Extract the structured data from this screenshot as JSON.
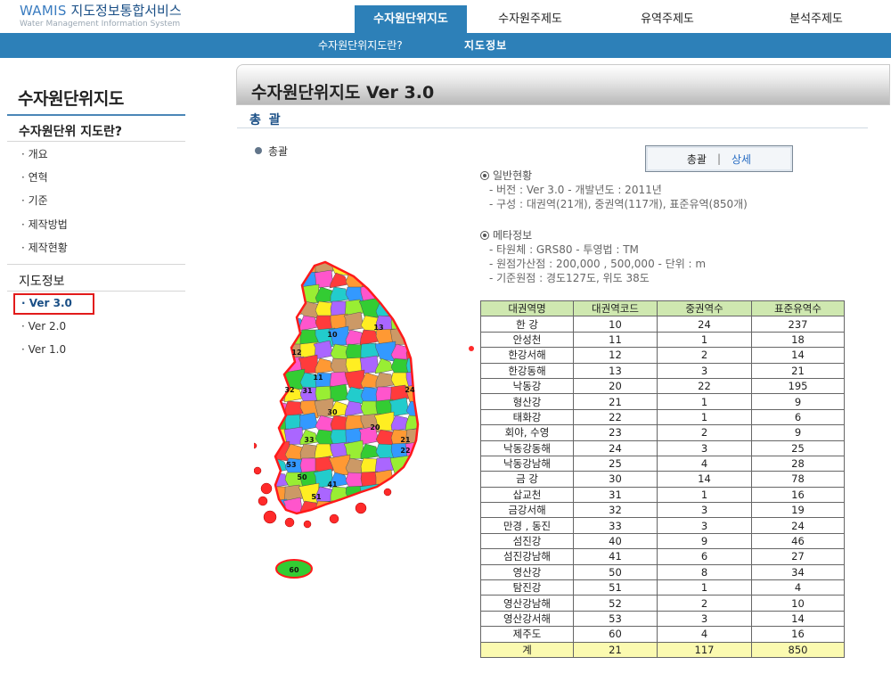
{
  "header": {
    "logo_brand": "WAMIS",
    "logo_title": "지도정보통합서비스",
    "logo_subtitle": "Water Management Information System",
    "main_menu": [
      "수자원단위지도",
      "수자원주제도",
      "유역주제도",
      "분석주제도"
    ],
    "sub_menu": [
      "수자원단위지도란?",
      "지도정보"
    ]
  },
  "sidebar": {
    "title": "수자원단위지도",
    "section1_title": "수자원단위 지도란?",
    "section1_items": [
      "· 개요",
      "· 연혁",
      "· 기준",
      "· 제작방법",
      "· 제작현황"
    ],
    "section2_title": "지도정보",
    "section2_items": [
      "· Ver 3.0",
      "· Ver 2.0",
      "· Ver 1.0"
    ],
    "active_item": "· Ver 3.0"
  },
  "content": {
    "page_title": "수자원단위지도 Ver 3.0",
    "tab_label": "총 괄",
    "bullet_label": "총괄",
    "toggle_summary": "총괄",
    "toggle_separator": "|",
    "toggle_detail": "상세",
    "general": {
      "heading": "일반현황",
      "lines": [
        "-  버전 : Ver 3.0        -  개발년도 : 2011년",
        "-  구성 : 대권역(21개), 중권역(117개), 표준유역(850개)"
      ]
    },
    "meta": {
      "heading": "메타정보",
      "lines": [
        "-  타원체 : GRS80     -  투영법 : TM",
        "-  원점가산점 : 200,000 , 500,000          -  단위 : m",
        "-  기준원점 : 경도127도, 위도 38도"
      ]
    }
  },
  "table": {
    "headers": [
      "대권역명",
      "대권역코드",
      "중권역수",
      "표준유역수"
    ],
    "rows": [
      [
        "한 강",
        "10",
        "24",
        "237"
      ],
      [
        "안성천",
        "11",
        "1",
        "18"
      ],
      [
        "한강서해",
        "12",
        "2",
        "14"
      ],
      [
        "한강동해",
        "13",
        "3",
        "21"
      ],
      [
        "낙동강",
        "20",
        "22",
        "195"
      ],
      [
        "형산강",
        "21",
        "1",
        "9"
      ],
      [
        "태화강",
        "22",
        "1",
        "6"
      ],
      [
        "회야, 수영",
        "23",
        "2",
        "9"
      ],
      [
        "낙동강동해",
        "24",
        "3",
        "25"
      ],
      [
        "낙동강남해",
        "25",
        "4",
        "28"
      ],
      [
        "금 강",
        "30",
        "14",
        "78"
      ],
      [
        "삽교천",
        "31",
        "1",
        "16"
      ],
      [
        "금강서해",
        "32",
        "3",
        "19"
      ],
      [
        "만경 , 동진",
        "33",
        "3",
        "24"
      ],
      [
        "섬진강",
        "40",
        "9",
        "46"
      ],
      [
        "섬진강남해",
        "41",
        "6",
        "27"
      ],
      [
        "영산강",
        "50",
        "8",
        "34"
      ],
      [
        "탐진강",
        "51",
        "1",
        "4"
      ],
      [
        "영산강남해",
        "52",
        "2",
        "10"
      ],
      [
        "영산강서해",
        "53",
        "3",
        "14"
      ],
      [
        "제주도",
        "60",
        "4",
        "16"
      ]
    ],
    "total": [
      "계",
      "21",
      "117",
      "850"
    ]
  },
  "map": {
    "labels": [
      {
        "code": "10"
      },
      {
        "code": "11"
      },
      {
        "code": "12"
      },
      {
        "code": "13"
      },
      {
        "code": "20"
      },
      {
        "code": "21"
      },
      {
        "code": "22"
      },
      {
        "code": "24"
      },
      {
        "code": "30"
      },
      {
        "code": "31"
      },
      {
        "code": "32"
      },
      {
        "code": "33"
      },
      {
        "code": "41"
      },
      {
        "code": "50"
      },
      {
        "code": "51"
      },
      {
        "code": "53"
      },
      {
        "code": "60"
      }
    ],
    "colors": [
      "#ff55cc",
      "#33cc33",
      "#ffee22",
      "#ff3b3b",
      "#22cccc",
      "#aa66ff",
      "#ff9933",
      "#3399ff",
      "#99ee33",
      "#cc9966"
    ]
  }
}
